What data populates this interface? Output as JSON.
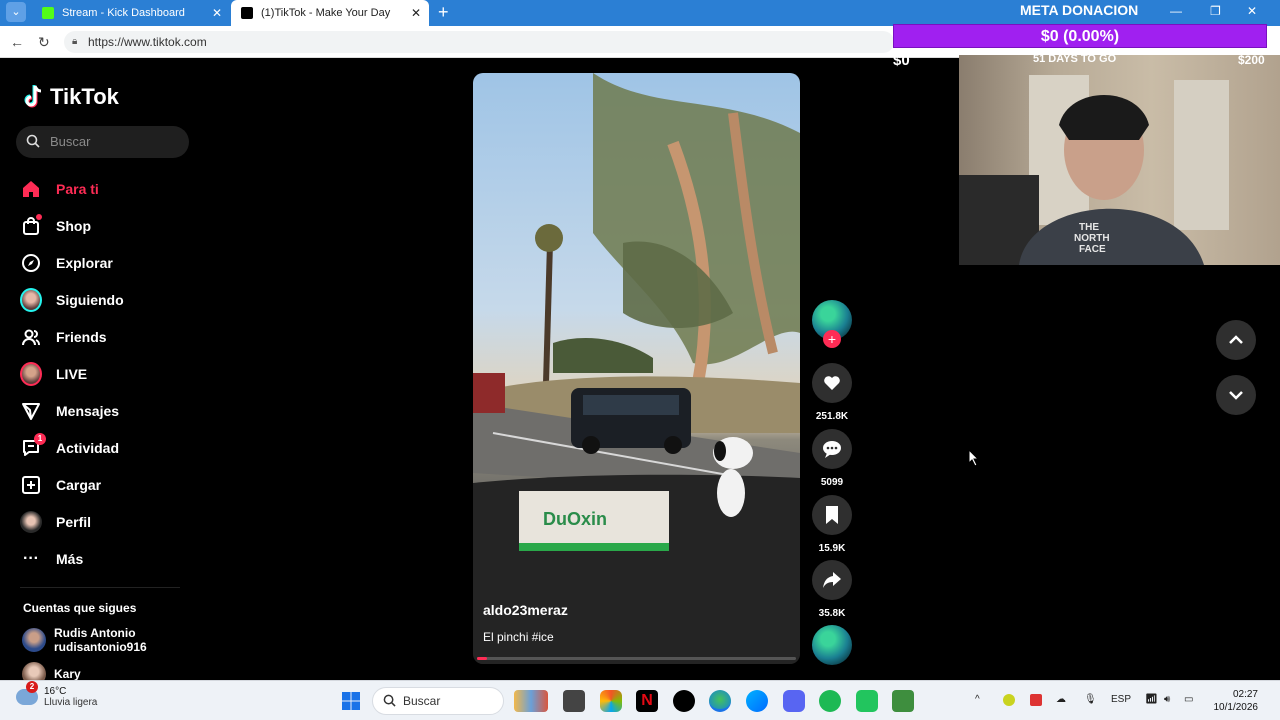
{
  "browser": {
    "tabs": [
      {
        "label": "Stream - Kick Dashboard",
        "color": "#53fc18"
      },
      {
        "label": "(1)TikTok - Make Your Day",
        "color": "#000000"
      }
    ],
    "url": "https://www.tiktok.com"
  },
  "tiktok": {
    "logo": "TikTok",
    "search_placeholder": "Buscar",
    "nav": [
      {
        "label": "Para ti",
        "icon": "home-icon"
      },
      {
        "label": "Shop",
        "icon": "shop-bag-icon"
      },
      {
        "label": "Explorar",
        "icon": "compass-icon"
      },
      {
        "label": "Siguiendo",
        "icon": "avatar-icon"
      },
      {
        "label": "Friends",
        "icon": "friends-icon"
      },
      {
        "label": "LIVE",
        "icon": "live-avatar-icon"
      },
      {
        "label": "Mensajes",
        "icon": "send-icon"
      },
      {
        "label": "Actividad",
        "icon": "activity-icon",
        "badge": "1"
      },
      {
        "label": "Cargar",
        "icon": "upload-icon"
      },
      {
        "label": "Perfil",
        "icon": "profile-icon"
      },
      {
        "label": "Más",
        "icon": "more-icon"
      }
    ],
    "following_title": "Cuentas que sigues",
    "following": [
      {
        "name": "Rudis Antonio",
        "handle": "rudisantonio916"
      },
      {
        "name": "Kary",
        "handle": ""
      }
    ],
    "video": {
      "username": "aldo23meraz",
      "caption": "El pinchi #ice",
      "progress": 0.03
    },
    "actions": {
      "likes": "251.8K",
      "comments": "5099",
      "saves": "15.9K",
      "shares": "35.8K"
    }
  },
  "overlay": {
    "title": "META DONACION",
    "progress_text": "$0 (0.00%)",
    "low": "$0",
    "days": "51 DAYS TO GO",
    "high": "$200",
    "bar_color": "#a020f0"
  },
  "taskbar": {
    "weather_temp": "16°C",
    "weather_desc": "Lluvia ligera",
    "weather_badge": "2",
    "search_label": "Buscar",
    "language": "ESP",
    "time": "02:27",
    "date": "10/1/2026"
  }
}
